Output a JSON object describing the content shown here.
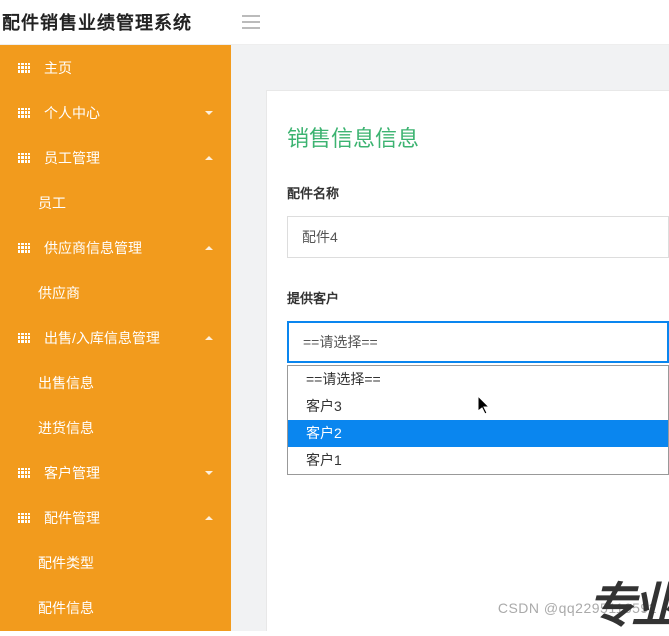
{
  "header": {
    "title": "配件销售业绩管理系统"
  },
  "sidebar": {
    "items": [
      {
        "label": "主页",
        "hasIcon": true,
        "expandable": false
      },
      {
        "label": "个人中心",
        "hasIcon": true,
        "expandable": true,
        "expanded": false
      },
      {
        "label": "员工管理",
        "hasIcon": true,
        "expandable": true,
        "expanded": true
      },
      {
        "label": "员工",
        "sub": true
      },
      {
        "label": "供应商信息管理",
        "hasIcon": true,
        "expandable": true,
        "expanded": true
      },
      {
        "label": "供应商",
        "sub": true
      },
      {
        "label": "出售/入库信息管理",
        "hasIcon": true,
        "expandable": true,
        "expanded": true
      },
      {
        "label": "出售信息",
        "sub": true
      },
      {
        "label": "进货信息",
        "sub": true
      },
      {
        "label": "客户管理",
        "hasIcon": true,
        "expandable": true,
        "expanded": false
      },
      {
        "label": "配件管理",
        "hasIcon": true,
        "expandable": true,
        "expanded": true
      },
      {
        "label": "配件类型",
        "sub": true
      },
      {
        "label": "配件信息",
        "sub": true
      }
    ]
  },
  "main": {
    "title": "销售信息信息",
    "field1_label": "配件名称",
    "field1_value": "配件4",
    "field2_label": "提供客户",
    "field2_value": "==请选择==",
    "dropdown": {
      "options": [
        "==请选择==",
        "客户3",
        "客户2",
        "客户1"
      ],
      "highlighted": "客户2"
    }
  },
  "watermark": "CSDN @qq2295116592"
}
